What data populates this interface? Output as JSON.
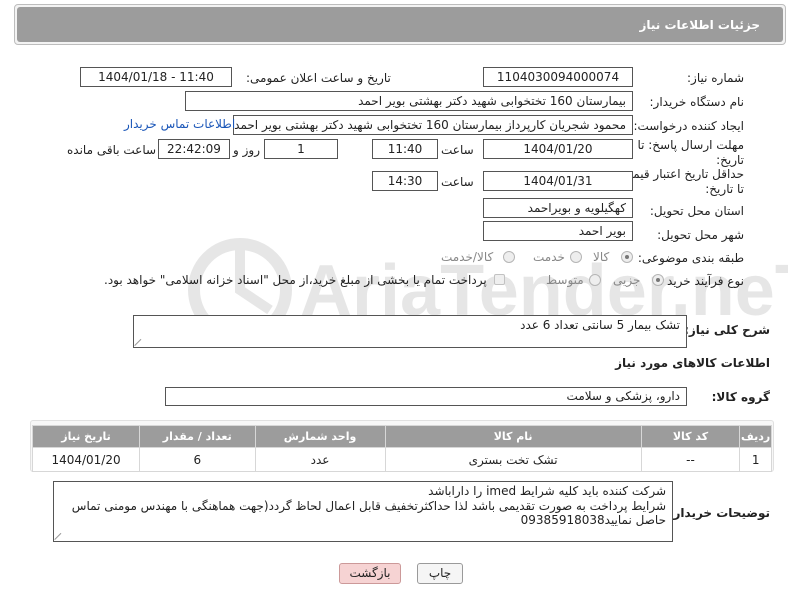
{
  "header": {
    "title": "جزئیات اطلاعات نیاز"
  },
  "fields": {
    "need_number_label": "شماره نیاز:",
    "need_number": "1104030094000074",
    "announce_label": "تاریخ و ساعت اعلان عمومی:",
    "announce_value": "1404/01/18 - 11:40",
    "buyer_org_label": "نام دستگاه خریدار:",
    "buyer_org": "بیمارستان 160 تختخوابی شهید دکتر بهشتی بویر احمد",
    "creator_label": "ایجاد کننده درخواست:",
    "creator": "محمود شجریان کارپرداز بیمارستان 160 تختخوابی شهید دکتر بهشتی بویر احمد",
    "contact_link": "اطلاعات تماس خریدار",
    "reply_deadline_label": "مهلت ارسال پاسخ: تا تاریخ:",
    "reply_date": "1404/01/20",
    "time_label": "ساعت",
    "reply_time": "11:40",
    "days_value": "1",
    "days_label": "روز و",
    "remaining_value": "22:42:09",
    "remaining_label": "ساعت باقی مانده",
    "price_validity_label": "حداقل تاریخ اعتبار قیمت: تا تاریخ:",
    "price_date": "1404/01/31",
    "price_time": "14:30",
    "province_label": "استان محل تحویل:",
    "province": "کهگیلویه و بویراحمد",
    "city_label": "شهر محل تحویل:",
    "city": "بویر احمد",
    "category_label": "طبقه بندی موضوعی:",
    "category_options": [
      "کالا",
      "خدمت",
      "کالا/خدمت"
    ],
    "process_label": "نوع فرآیند خرید :",
    "process_options": [
      "جزیی",
      "متوسط"
    ],
    "payment_note": "پرداخت تمام یا بخشی از مبلغ خرید،از محل \"اسناد خزانه اسلامی\" خواهد بود."
  },
  "description": {
    "label": "شرح کلی نیاز:",
    "value": "تشک بیمار 5 سانتی تعداد 6 عدد"
  },
  "goods_section": {
    "title": "اطلاعات کالاهای مورد نیاز"
  },
  "goods_group": {
    "label": "گروه کالا:",
    "value": "دارو، پزشکی و سلامت"
  },
  "table": {
    "headers": [
      "ردیف",
      "کد کالا",
      "نام کالا",
      "واحد شمارش",
      "تعداد / مقدار",
      "تاریخ نیاز"
    ],
    "rows": [
      [
        "1",
        "--",
        "تشک تخت بستری",
        "عدد",
        "6",
        "1404/01/20"
      ]
    ]
  },
  "buyer_notes": {
    "label": "توضیحات خریدار:",
    "lines": [
      "شرکت کننده باید کلیه شرایط   imed  را داراباشد",
      "شرایط پرداخت به صورت تقدیمی باشد لذا حداکثرتخفیف قابل اعمال لحاظ گردد(جهت هماهنگی با مهندس مومنی تماس",
      "حاصل نمایید09385918038"
    ]
  },
  "buttons": {
    "print": "چاپ",
    "back": "بازگشت"
  },
  "watermark_text": "AriaTender.neT",
  "colors": {
    "header_bg": "#9c9c9c",
    "link": "#1a56b8",
    "back_button_bg": "#f6d3d3"
  }
}
